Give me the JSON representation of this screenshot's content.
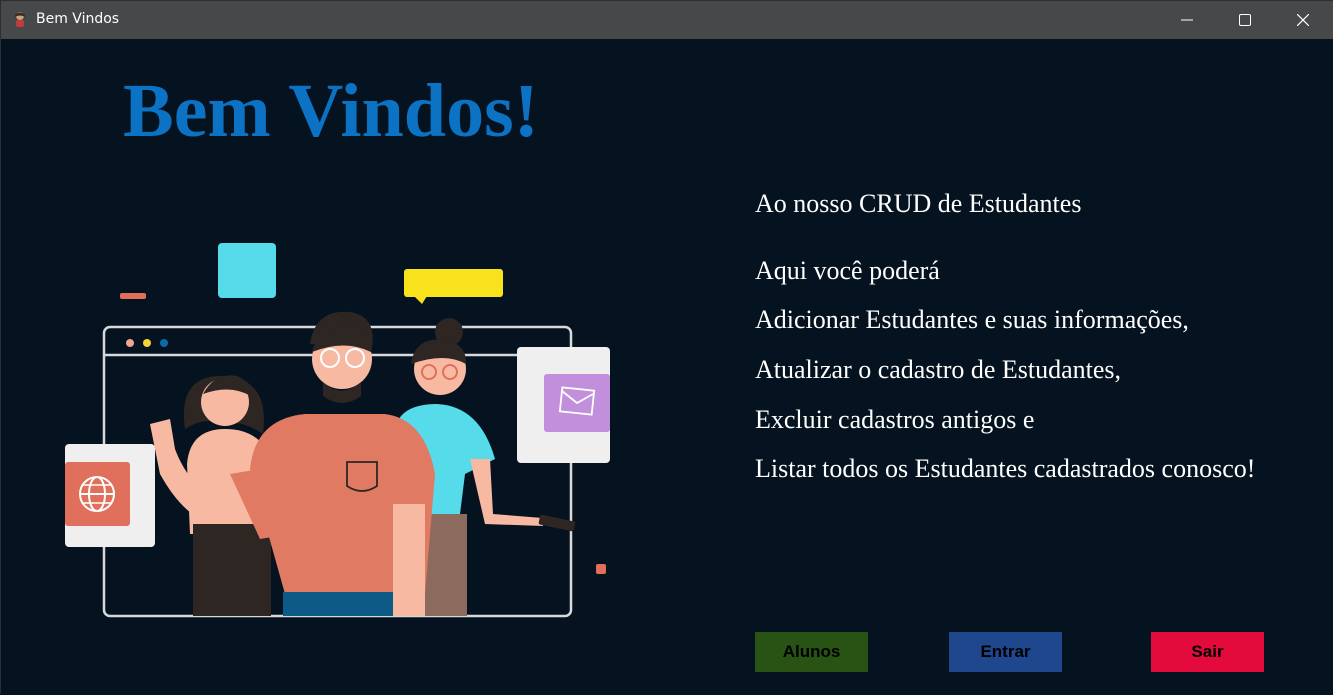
{
  "window": {
    "title": "Bem Vindos",
    "icon": "person-app-icon"
  },
  "headline": "Bem Vindos!",
  "intro": {
    "subtitle": "Ao nosso CRUD de Estudantes",
    "lines": [
      "Aqui você poderá",
      "Adicionar Estudantes e suas informações,",
      "Atualizar o cadastro de Estudantes,",
      "Excluir cadastros antigos e",
      "Listar todos os Estudantes cadastrados conosco!"
    ]
  },
  "buttons": {
    "alunos": "Alunos",
    "entrar": "Entrar",
    "sair": "Sair"
  },
  "colors": {
    "background": "#04131f",
    "headline": "#0b72c4",
    "alunos": "#285314",
    "entrar": "#1e478d",
    "sair": "#e30a3c"
  }
}
